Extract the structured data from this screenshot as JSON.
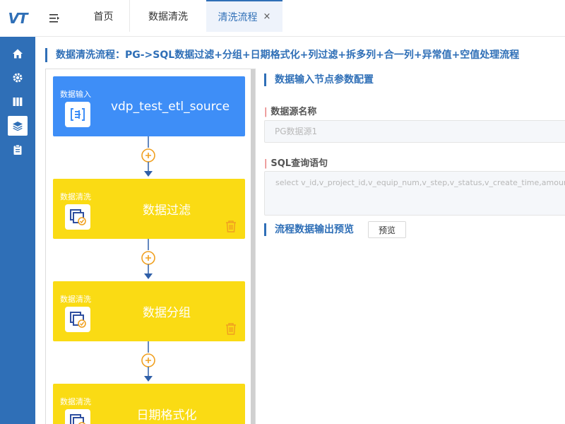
{
  "app": {
    "logo": "VT"
  },
  "nav": {
    "items": [
      {
        "icon": "home-icon"
      },
      {
        "icon": "gear-icon"
      },
      {
        "icon": "book-icon"
      },
      {
        "icon": "layers-icon",
        "active": true
      },
      {
        "icon": "clipboard-icon"
      }
    ]
  },
  "tabs": [
    {
      "label": "首页"
    },
    {
      "label": "数据清洗"
    },
    {
      "label": "清洗流程",
      "active": true,
      "close": "×"
    }
  ],
  "page": {
    "title": "数据清洗流程：PG->SQL数据过滤+分组+日期格式化+列过滤+拆多列+合一列+异常值+空值处理流程"
  },
  "flow": {
    "nodes": [
      {
        "type": "数据输入",
        "name": "vdp_test_etl_source",
        "kind": "input"
      },
      {
        "type": "数据清洗",
        "name": "数据过滤",
        "kind": "clean"
      },
      {
        "type": "数据清洗",
        "name": "数据分组",
        "kind": "clean"
      },
      {
        "type": "数据清洗",
        "name": "日期格式化",
        "kind": "clean"
      }
    ]
  },
  "config": {
    "section_title": "数据输入节点参数配置",
    "datasource_label": "数据源名称",
    "datasource_value": "PG数据源1",
    "sql_label": "SQL查询语句",
    "sql_value": "select v_id,v_project_id,v_equip_num,v_step,v_status,v_create_time,amount,nc_",
    "required_mark": "|"
  },
  "preview": {
    "section_title": "流程数据输出预览",
    "button_label": "预览"
  },
  "colors": {
    "primary": "#2f6fb7",
    "input_node": "#3e8ef7",
    "clean_node": "#fadb14",
    "plus_icon": "#f0a020",
    "trash_icon": "#f0a020"
  }
}
